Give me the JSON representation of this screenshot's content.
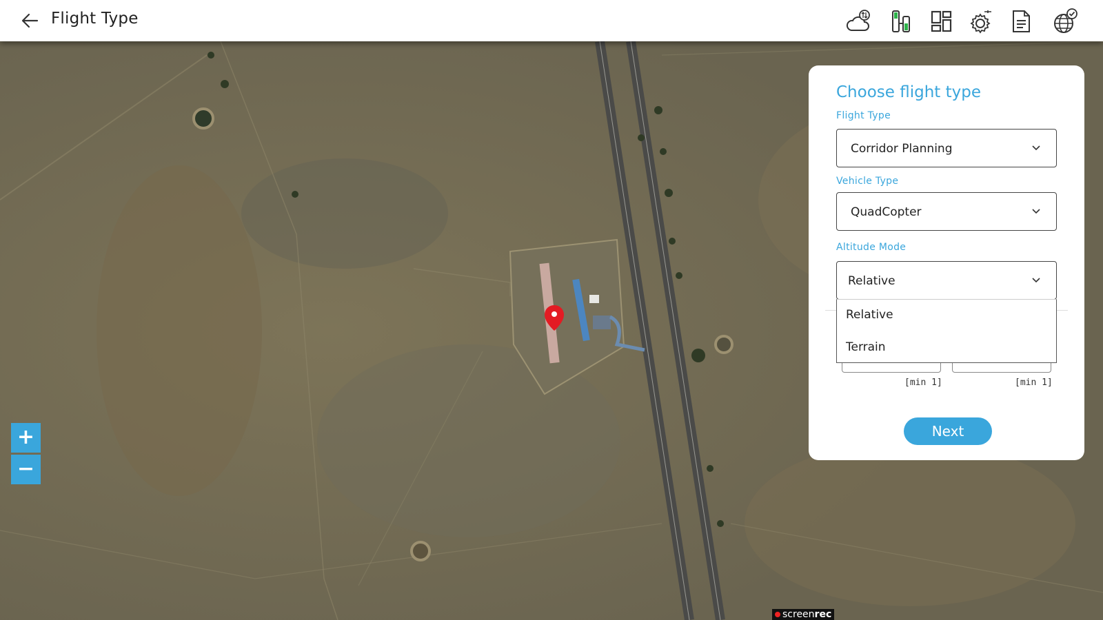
{
  "header": {
    "title": "Flight Type",
    "icons": [
      "back-arrow-icon",
      "cloud-sync-icon",
      "battery-status-icon",
      "layout-icon",
      "drone-settings-icon",
      "document-icon",
      "globe-check-icon"
    ]
  },
  "panel": {
    "title": "Choose flight type",
    "flight_type": {
      "label": "Flight Type",
      "value": "Corridor Planning"
    },
    "vehicle_type": {
      "label": "Vehicle Type",
      "value": "QuadCopter"
    },
    "altitude_mode": {
      "label": "Altitude Mode",
      "value": "Relative",
      "options": [
        "Relative",
        "Terrain"
      ]
    },
    "min_hint_left": "[min 1]",
    "min_hint_right": "[min 1]",
    "next_label": "Next"
  },
  "zoom": {
    "in_label": "+",
    "out_label": "−"
  },
  "watermark": {
    "prefix": "screen",
    "suffix": "rec"
  },
  "colors": {
    "accent": "#3aa6dc",
    "marker": "#e31b23"
  }
}
